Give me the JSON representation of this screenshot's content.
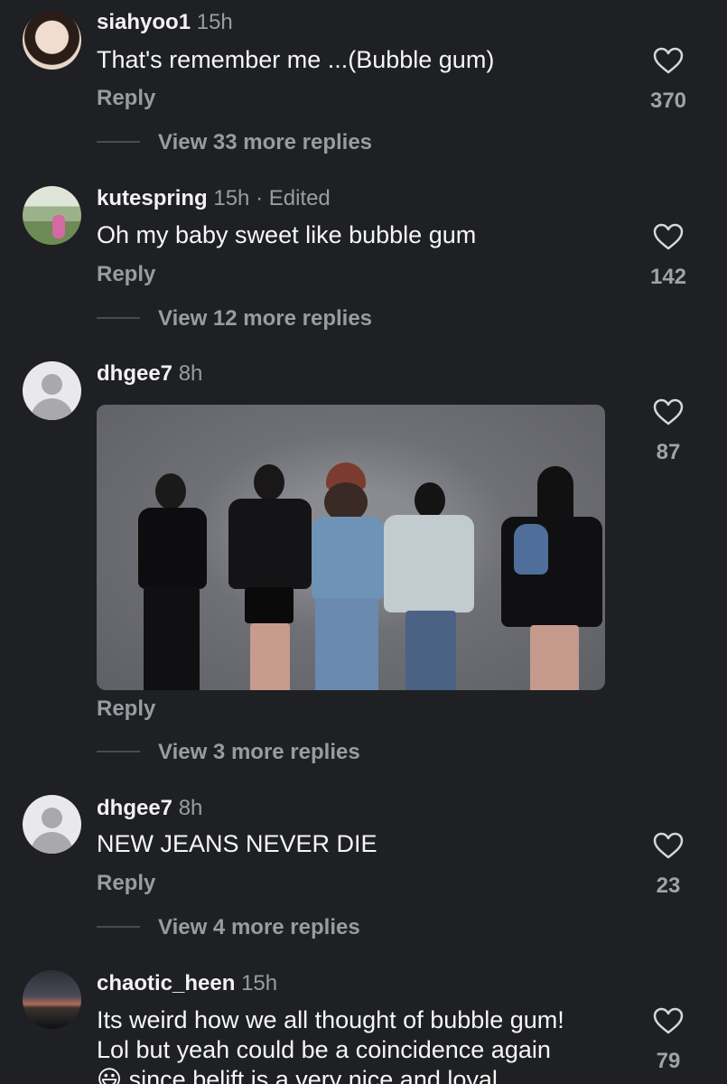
{
  "comments": [
    {
      "username": "siahyoo1",
      "time": "15h",
      "text": "That's remember me ...(Bubble gum)",
      "reply": "Reply",
      "view_replies": "View 33 more replies",
      "likes": "370"
    },
    {
      "username": "kutespring",
      "time": "15h · Edited",
      "text": "Oh my baby sweet like bubble gum",
      "reply": "Reply",
      "view_replies": "View 12 more replies",
      "likes": "142"
    },
    {
      "username": "dhgee7",
      "time": "8h",
      "reply": "Reply",
      "view_replies": "View 3 more replies",
      "likes": "87"
    },
    {
      "username": "dhgee7",
      "time": "8h",
      "text": "NEW JEANS NEVER DIE",
      "reply": "Reply",
      "view_replies": "View 4 more replies",
      "likes": "23"
    },
    {
      "username": "chaotic_heen",
      "time": "15h",
      "text_lines": [
        "Its weird how we all thought of bubble gum!",
        "Lol but yeah could be a coincidence again",
        "since belift is a very nice and loyal"
      ],
      "emoji": "😃",
      "likes": "79"
    }
  ],
  "icons": {
    "heart": "heart-icon"
  }
}
